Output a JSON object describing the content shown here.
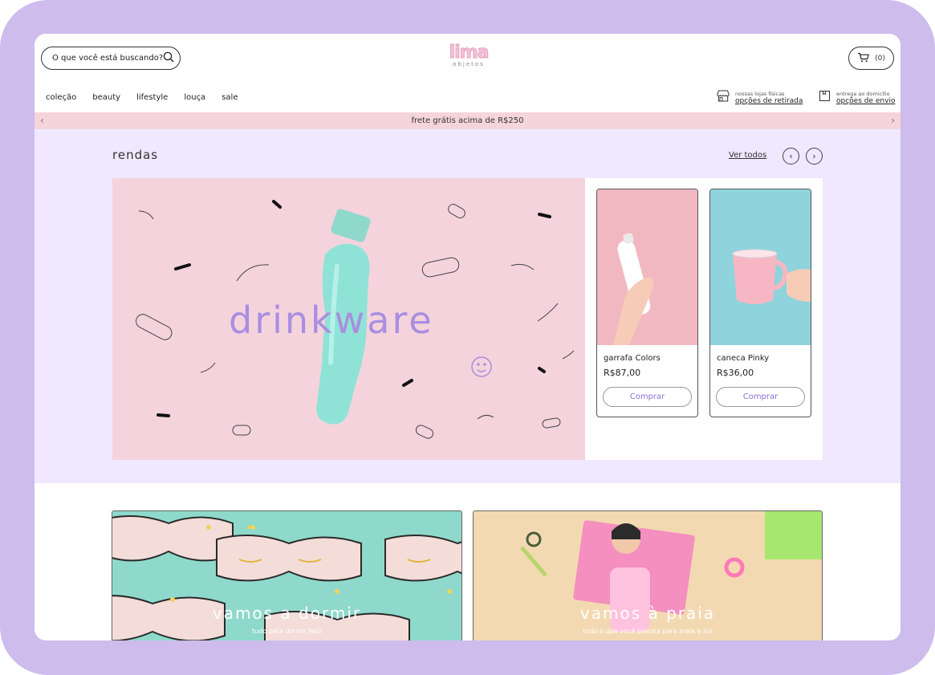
{
  "header": {
    "search_placeholder": "O que você está buscando?",
    "logo_text": "lima",
    "logo_subtitle": "objetos",
    "cart_count": "(0)"
  },
  "nav": {
    "items": [
      "coleção",
      "beauty",
      "lifestyle",
      "louça",
      "sale"
    ]
  },
  "store_info": {
    "stores_label": "nossas lojas físicas",
    "stores_link": "opções de retirada",
    "delivery_label": "entrega ao domicílio",
    "delivery_link": "opções de envio"
  },
  "promo_bar": {
    "text": "frete grátis acima de R$250"
  },
  "featured": {
    "title": "rendas",
    "view_all": "Ver todos",
    "hero_word": "drinkware",
    "products": [
      {
        "name": "garrafa Colors",
        "price": "R$87,00",
        "button": "Comprar"
      },
      {
        "name": "caneca Pinky",
        "price": "R$36,00",
        "button": "Comprar"
      }
    ]
  },
  "banners": [
    {
      "title": "vamos a dormir",
      "subtitle": "tudo para dormir feliz"
    },
    {
      "title": "vamos à praia",
      "subtitle": "tudo o que você precisa para areia e sol"
    }
  ],
  "colors": {
    "frame": "#cdbcec",
    "section_bg": "#efe8fe",
    "promo_bg": "#f5d4dc",
    "accent_purple": "#a98ee0",
    "hero_bg": "#f4d3dd",
    "mint": "#8fe3d6"
  }
}
